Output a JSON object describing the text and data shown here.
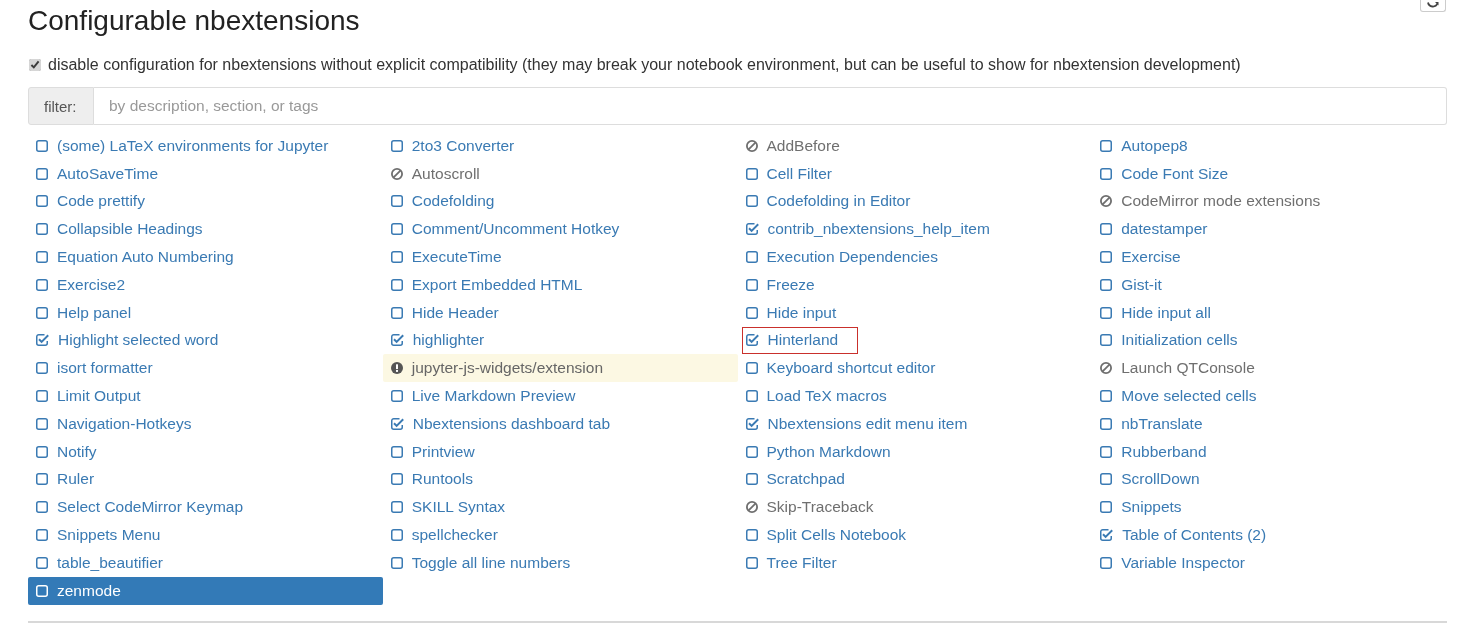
{
  "page": {
    "title": "Configurable nbextensions"
  },
  "compat_option": {
    "checked": true,
    "label": "disable configuration for nbextensions without explicit compatibility (they may break your notebook environment, but can be useful to show for nbextension development)"
  },
  "filter": {
    "label": "filter:",
    "placeholder": "by description, section, or tags"
  },
  "extensions": [
    {
      "label": "(some) LaTeX environments for Jupyter",
      "kind": "checkbox",
      "checked": false,
      "selected": false,
      "boxed": false
    },
    {
      "label": "2to3 Converter",
      "kind": "checkbox",
      "checked": false,
      "selected": false,
      "boxed": false
    },
    {
      "label": "AddBefore",
      "kind": "incompatible",
      "selected": false,
      "boxed": false
    },
    {
      "label": "Autopep8",
      "kind": "checkbox",
      "checked": false,
      "selected": false,
      "boxed": false
    },
    {
      "label": "AutoSaveTime",
      "kind": "checkbox",
      "checked": false,
      "selected": false,
      "boxed": false
    },
    {
      "label": "Autoscroll",
      "kind": "incompatible",
      "selected": false,
      "boxed": false
    },
    {
      "label": "Cell Filter",
      "kind": "checkbox",
      "checked": false,
      "selected": false,
      "boxed": false
    },
    {
      "label": "Code Font Size",
      "kind": "checkbox",
      "checked": false,
      "selected": false,
      "boxed": false
    },
    {
      "label": "Code prettify",
      "kind": "checkbox",
      "checked": false,
      "selected": false,
      "boxed": false
    },
    {
      "label": "Codefolding",
      "kind": "checkbox",
      "checked": false,
      "selected": false,
      "boxed": false
    },
    {
      "label": "Codefolding in Editor",
      "kind": "checkbox",
      "checked": false,
      "selected": false,
      "boxed": false
    },
    {
      "label": "CodeMirror mode extensions",
      "kind": "incompatible",
      "selected": false,
      "boxed": false
    },
    {
      "label": "Collapsible Headings",
      "kind": "checkbox",
      "checked": false,
      "selected": false,
      "boxed": false
    },
    {
      "label": "Comment/Uncomment Hotkey",
      "kind": "checkbox",
      "checked": false,
      "selected": false,
      "boxed": false
    },
    {
      "label": "contrib_nbextensions_help_item",
      "kind": "checkbox",
      "checked": true,
      "selected": false,
      "boxed": false
    },
    {
      "label": "datestamper",
      "kind": "checkbox",
      "checked": false,
      "selected": false,
      "boxed": false
    },
    {
      "label": "Equation Auto Numbering",
      "kind": "checkbox",
      "checked": false,
      "selected": false,
      "boxed": false
    },
    {
      "label": "ExecuteTime",
      "kind": "checkbox",
      "checked": false,
      "selected": false,
      "boxed": false
    },
    {
      "label": "Execution Dependencies",
      "kind": "checkbox",
      "checked": false,
      "selected": false,
      "boxed": false
    },
    {
      "label": "Exercise",
      "kind": "checkbox",
      "checked": false,
      "selected": false,
      "boxed": false
    },
    {
      "label": "Exercise2",
      "kind": "checkbox",
      "checked": false,
      "selected": false,
      "boxed": false
    },
    {
      "label": "Export Embedded HTML",
      "kind": "checkbox",
      "checked": false,
      "selected": false,
      "boxed": false
    },
    {
      "label": "Freeze",
      "kind": "checkbox",
      "checked": false,
      "selected": false,
      "boxed": false
    },
    {
      "label": "Gist-it",
      "kind": "checkbox",
      "checked": false,
      "selected": false,
      "boxed": false
    },
    {
      "label": "Help panel",
      "kind": "checkbox",
      "checked": false,
      "selected": false,
      "boxed": false
    },
    {
      "label": "Hide Header",
      "kind": "checkbox",
      "checked": false,
      "selected": false,
      "boxed": false
    },
    {
      "label": "Hide input",
      "kind": "checkbox",
      "checked": false,
      "selected": false,
      "boxed": false
    },
    {
      "label": "Hide input all",
      "kind": "checkbox",
      "checked": false,
      "selected": false,
      "boxed": false
    },
    {
      "label": "Highlight selected word",
      "kind": "checkbox",
      "checked": true,
      "selected": false,
      "boxed": false
    },
    {
      "label": "highlighter",
      "kind": "checkbox",
      "checked": true,
      "selected": false,
      "boxed": false
    },
    {
      "label": "Hinterland",
      "kind": "checkbox",
      "checked": true,
      "selected": false,
      "boxed": true
    },
    {
      "label": "Initialization cells",
      "kind": "checkbox",
      "checked": false,
      "selected": false,
      "boxed": false
    },
    {
      "label": "isort formatter",
      "kind": "checkbox",
      "checked": false,
      "selected": false,
      "boxed": false
    },
    {
      "label": "jupyter-js-widgets/extension",
      "kind": "warning",
      "selected": false,
      "boxed": false
    },
    {
      "label": "Keyboard shortcut editor",
      "kind": "checkbox",
      "checked": false,
      "selected": false,
      "boxed": false
    },
    {
      "label": "Launch QTConsole",
      "kind": "incompatible",
      "selected": false,
      "boxed": false
    },
    {
      "label": "Limit Output",
      "kind": "checkbox",
      "checked": false,
      "selected": false,
      "boxed": false
    },
    {
      "label": "Live Markdown Preview",
      "kind": "checkbox",
      "checked": false,
      "selected": false,
      "boxed": false
    },
    {
      "label": "Load TeX macros",
      "kind": "checkbox",
      "checked": false,
      "selected": false,
      "boxed": false
    },
    {
      "label": "Move selected cells",
      "kind": "checkbox",
      "checked": false,
      "selected": false,
      "boxed": false
    },
    {
      "label": "Navigation-Hotkeys",
      "kind": "checkbox",
      "checked": false,
      "selected": false,
      "boxed": false
    },
    {
      "label": "Nbextensions dashboard tab",
      "kind": "checkbox",
      "checked": true,
      "selected": false,
      "boxed": false
    },
    {
      "label": "Nbextensions edit menu item",
      "kind": "checkbox",
      "checked": true,
      "selected": false,
      "boxed": false
    },
    {
      "label": "nbTranslate",
      "kind": "checkbox",
      "checked": false,
      "selected": false,
      "boxed": false
    },
    {
      "label": "Notify",
      "kind": "checkbox",
      "checked": false,
      "selected": false,
      "boxed": false
    },
    {
      "label": "Printview",
      "kind": "checkbox",
      "checked": false,
      "selected": false,
      "boxed": false
    },
    {
      "label": "Python Markdown",
      "kind": "checkbox",
      "checked": false,
      "selected": false,
      "boxed": false
    },
    {
      "label": "Rubberband",
      "kind": "checkbox",
      "checked": false,
      "selected": false,
      "boxed": false
    },
    {
      "label": "Ruler",
      "kind": "checkbox",
      "checked": false,
      "selected": false,
      "boxed": false
    },
    {
      "label": "Runtools",
      "kind": "checkbox",
      "checked": false,
      "selected": false,
      "boxed": false
    },
    {
      "label": "Scratchpad",
      "kind": "checkbox",
      "checked": false,
      "selected": false,
      "boxed": false
    },
    {
      "label": "ScrollDown",
      "kind": "checkbox",
      "checked": false,
      "selected": false,
      "boxed": false
    },
    {
      "label": "Select CodeMirror Keymap",
      "kind": "checkbox",
      "checked": false,
      "selected": false,
      "boxed": false
    },
    {
      "label": "SKILL Syntax",
      "kind": "checkbox",
      "checked": false,
      "selected": false,
      "boxed": false
    },
    {
      "label": "Skip-Traceback",
      "kind": "incompatible",
      "selected": false,
      "boxed": false
    },
    {
      "label": "Snippets",
      "kind": "checkbox",
      "checked": false,
      "selected": false,
      "boxed": false
    },
    {
      "label": "Snippets Menu",
      "kind": "checkbox",
      "checked": false,
      "selected": false,
      "boxed": false
    },
    {
      "label": "spellchecker",
      "kind": "checkbox",
      "checked": false,
      "selected": false,
      "boxed": false
    },
    {
      "label": "Split Cells Notebook",
      "kind": "checkbox",
      "checked": false,
      "selected": false,
      "boxed": false
    },
    {
      "label": "Table of Contents (2)",
      "kind": "checkbox",
      "checked": true,
      "selected": false,
      "boxed": false
    },
    {
      "label": "table_beautifier",
      "kind": "checkbox",
      "checked": false,
      "selected": false,
      "boxed": false
    },
    {
      "label": "Toggle all line numbers",
      "kind": "checkbox",
      "checked": false,
      "selected": false,
      "boxed": false
    },
    {
      "label": "Tree Filter",
      "kind": "checkbox",
      "checked": false,
      "selected": false,
      "boxed": false
    },
    {
      "label": "Variable Inspector",
      "kind": "checkbox",
      "checked": false,
      "selected": false,
      "boxed": false
    },
    {
      "label": "zenmode",
      "kind": "checkbox",
      "checked": false,
      "selected": true,
      "boxed": false
    }
  ]
}
